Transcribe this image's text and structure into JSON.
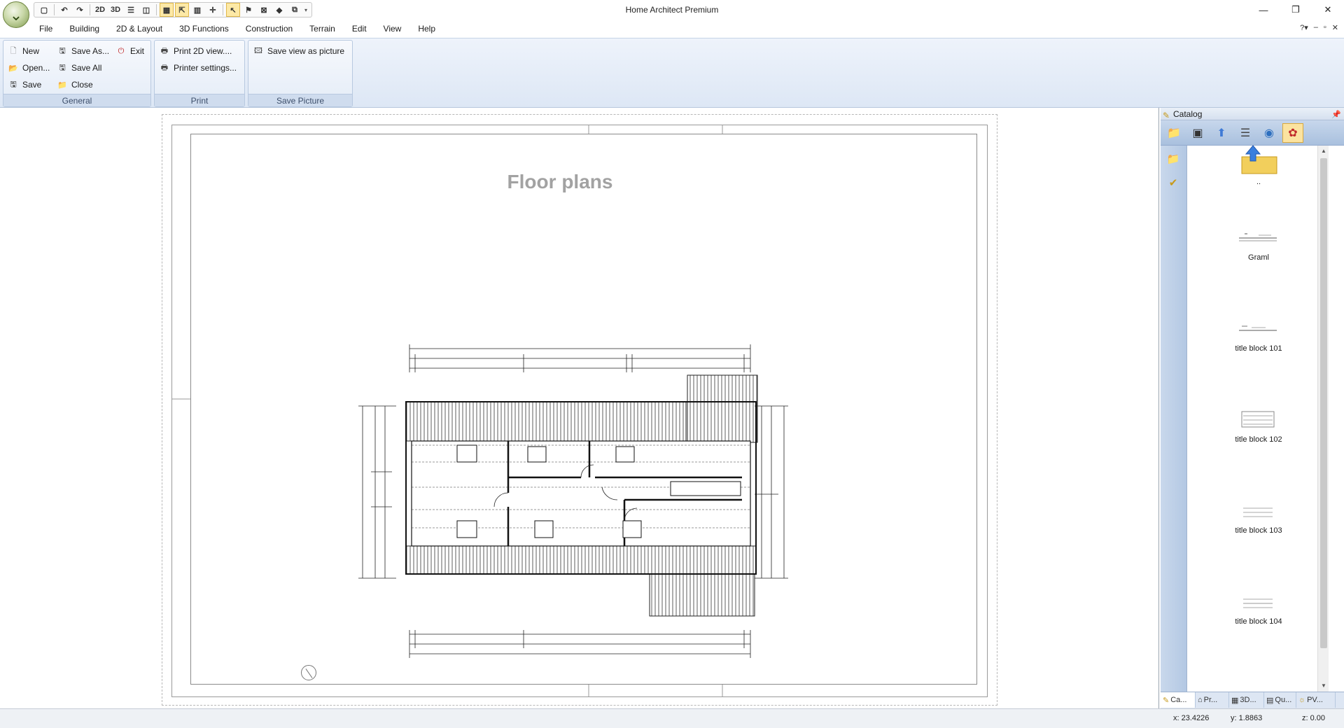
{
  "window": {
    "title": "Home Architect Premium",
    "controls": {
      "minimize": "—",
      "restore": "❐",
      "close": "✕"
    }
  },
  "quick_access": [
    {
      "name": "new-doc-icon",
      "glyph": "▢"
    },
    {
      "name": "undo-icon",
      "glyph": "↶"
    },
    {
      "name": "redo-icon",
      "glyph": "↷"
    },
    {
      "name": "2d-view-icon",
      "glyph": "2D"
    },
    {
      "name": "3d-view-icon",
      "glyph": "3D"
    },
    {
      "name": "split-horizontal-icon",
      "glyph": "☰"
    },
    {
      "name": "split-vertical-icon",
      "glyph": "◫"
    },
    {
      "name": "grid-icon",
      "glyph": "▦"
    },
    {
      "name": "snap-cursor-icon",
      "glyph": "⇱"
    },
    {
      "name": "columns-icon",
      "glyph": "▥"
    },
    {
      "name": "crosshair-icon",
      "glyph": "✛"
    },
    {
      "name": "select-pointer-icon",
      "glyph": "↖"
    },
    {
      "name": "flag-icon",
      "glyph": "⚑"
    },
    {
      "name": "measure-icon",
      "glyph": "⊠"
    },
    {
      "name": "paint-icon",
      "glyph": "◆"
    },
    {
      "name": "copy-icon",
      "glyph": "⧉"
    }
  ],
  "menu": [
    "File",
    "Building",
    "2D & Layout",
    "3D Functions",
    "Construction",
    "Terrain",
    "Edit",
    "View",
    "Help"
  ],
  "menu_right": {
    "help": "?▾",
    "minimize": "–",
    "restore": "▫",
    "close": "✕"
  },
  "ribbon": {
    "general": {
      "label": "General",
      "new": "New",
      "open": "Open...",
      "save": "Save",
      "save_as": "Save As...",
      "save_all": "Save All",
      "close": "Close",
      "exit": "Exit"
    },
    "print": {
      "label": "Print",
      "print_2d": "Print 2D view....",
      "printer_settings": "Printer settings..."
    },
    "save_picture": {
      "label": "Save Picture",
      "save_view": "Save view as picture"
    }
  },
  "drawing": {
    "title": "Floor plans"
  },
  "catalog": {
    "title": "Catalog",
    "items": [
      {
        "label": "..",
        "icon": "folder-up-icon"
      },
      {
        "label": "Graml"
      },
      {
        "label": "title block 101"
      },
      {
        "label": "title block 102"
      },
      {
        "label": "title block 103"
      },
      {
        "label": "title block 104"
      }
    ],
    "tabs": [
      "Ca...",
      "Pr...",
      "3D...",
      "Qu...",
      "PV..."
    ]
  },
  "status": {
    "x": "x: 23.4226",
    "y": "y: 1.8863",
    "z": "z: 0.00"
  },
  "colors": {
    "ribbon_bg": "#dde7f5",
    "accent_active": "#fde9a6",
    "title_gray": "#a2a2a2"
  }
}
